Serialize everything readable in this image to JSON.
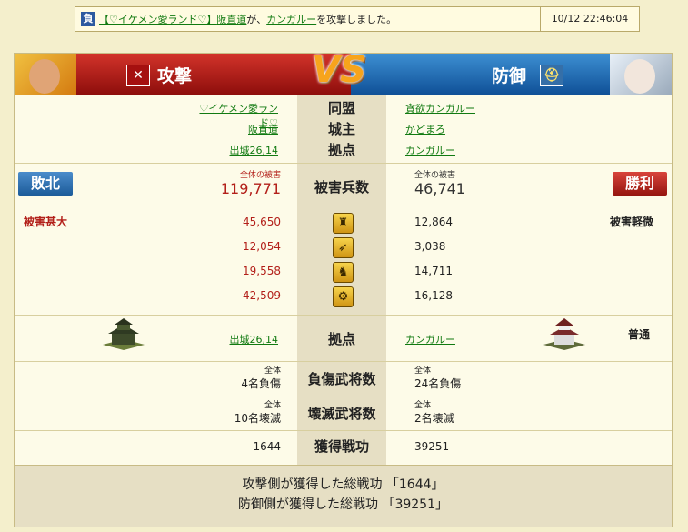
{
  "notice": {
    "badge": "負",
    "attacker_alliance": "【♡イケメン愛ランド♡】",
    "attacker": "阪直道",
    "text_mid": "が、",
    "target": "カンガルー",
    "text_end": "を攻撃しました。",
    "time": "10/12 22:46:04"
  },
  "header": {
    "attack_label": "攻撃",
    "defense_label": "防御",
    "vs": "VS",
    "attack_icon": "crossed-swords-icon",
    "defense_icon": "helmet-icon"
  },
  "info": {
    "alliance_label": "同盟",
    "lord_label": "城主",
    "base_label": "拠点",
    "attacker_alliance": "♡イケメン愛ランド♡",
    "attacker_lord": "阪直道",
    "attacker_base": "出城26,14",
    "defender_alliance": "貪欲カンガルー",
    "defender_lord": "かどまろ",
    "defender_base": "カンガルー"
  },
  "damage": {
    "label": "被害兵数",
    "caption": "全体の被害",
    "attacker_total": "119,771",
    "defender_total": "46,741",
    "attacker_result": "敗北",
    "defender_result": "勝利",
    "attacker_severity": "被害甚大",
    "defender_severity": "被害軽微",
    "units": [
      {
        "icon": "spearman-icon",
        "glyph": "♜",
        "attacker": "45,650",
        "defender": "12,864"
      },
      {
        "icon": "bow-icon",
        "glyph": "➶",
        "attacker": "12,054",
        "defender": "3,038"
      },
      {
        "icon": "horse-icon",
        "glyph": "♞",
        "attacker": "19,558",
        "defender": "14,711"
      },
      {
        "icon": "siege-icon",
        "glyph": "⚙",
        "attacker": "42,509",
        "defender": "16,128"
      }
    ]
  },
  "base": {
    "label": "拠点",
    "attacker_base": "出城26,14",
    "defender_base": "カンガルー",
    "defender_status": "普通"
  },
  "wounded": {
    "label": "負傷武将数",
    "caption": "全体",
    "attacker": "4名負傷",
    "defender": "24名負傷"
  },
  "destroyed": {
    "label": "壊滅武将数",
    "caption": "全体",
    "attacker": "10名壊滅",
    "defender": "2名壊滅"
  },
  "merit": {
    "label": "獲得戦功",
    "attacker": "1644",
    "defender": "39251"
  },
  "footer": {
    "line1": "攻撃側が獲得した総戦功 「1644」",
    "line2": "防御側が獲得した総戦功 「39251」"
  },
  "colors": {
    "attack_red": "#b3201a",
    "defense_blue": "#1c5b99",
    "link_green": "#117a11"
  }
}
